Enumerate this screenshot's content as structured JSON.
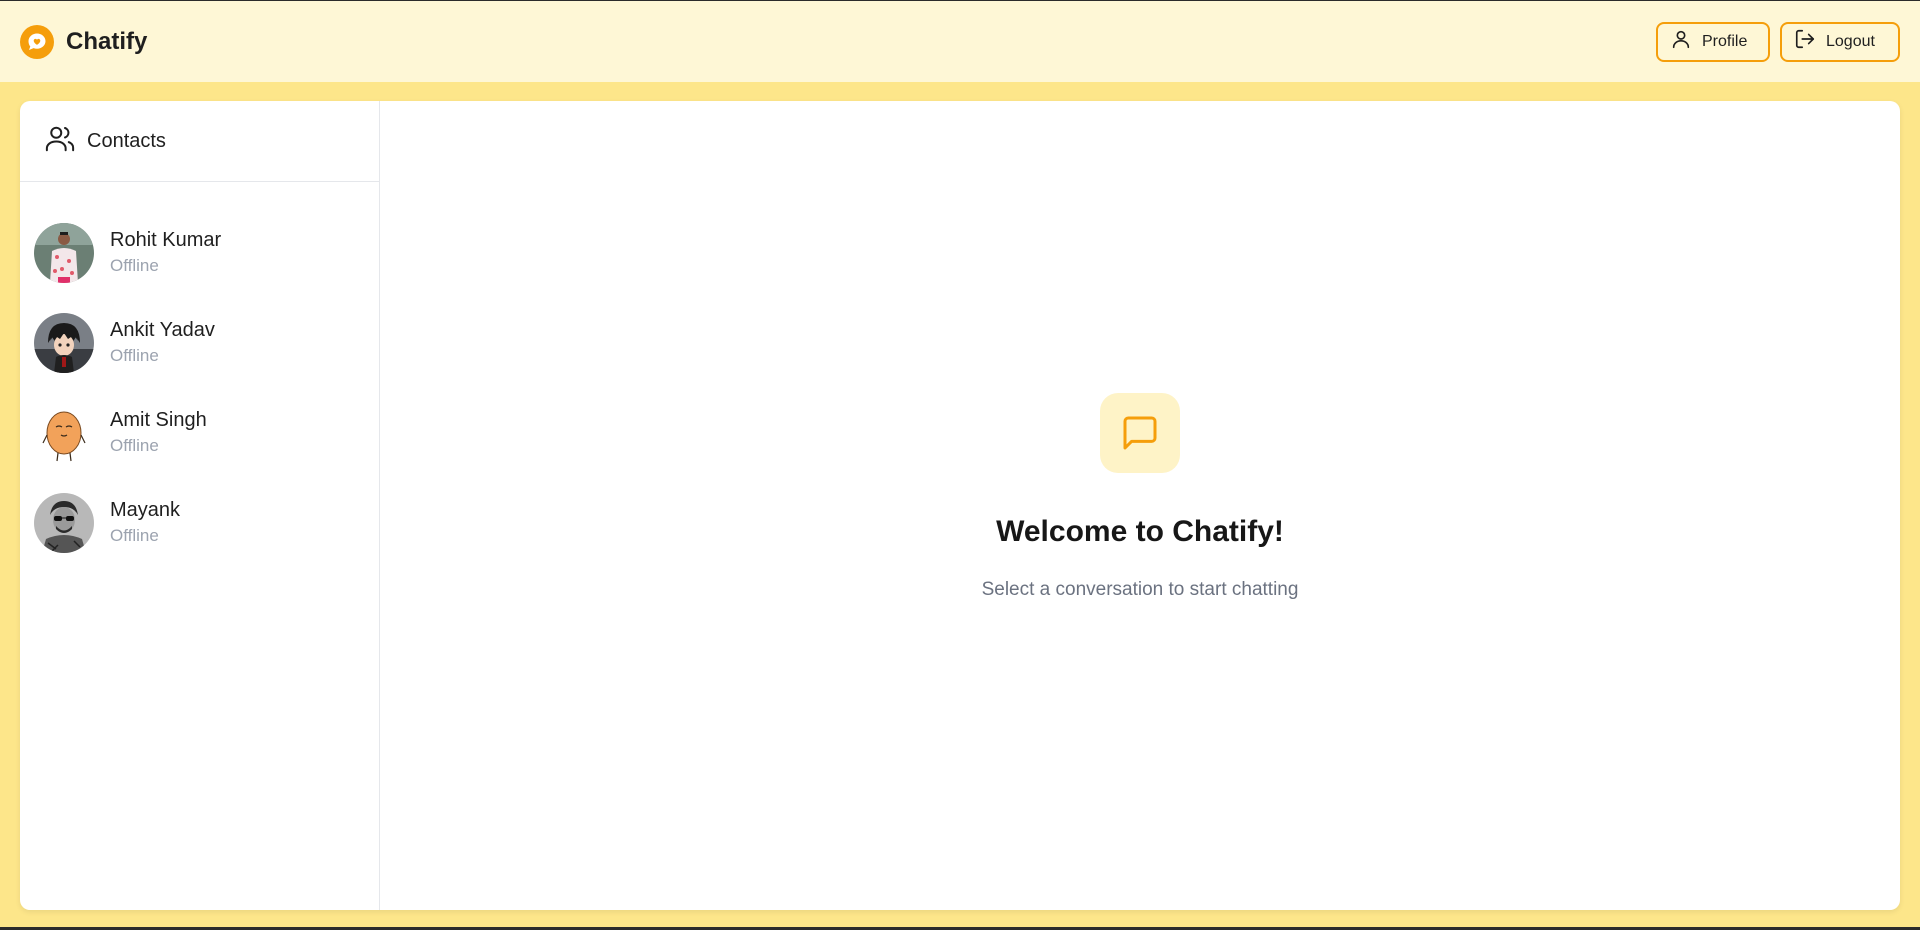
{
  "header": {
    "brand": "Chatify",
    "profile_label": "Profile",
    "logout_label": "Logout"
  },
  "sidebar": {
    "title": "Contacts",
    "contacts": [
      {
        "name": "Rohit Kumar",
        "status": "Offline"
      },
      {
        "name": "Ankit Yadav",
        "status": "Offline"
      },
      {
        "name": "Amit Singh",
        "status": "Offline"
      },
      {
        "name": "Mayank",
        "status": "Offline"
      }
    ]
  },
  "main": {
    "welcome_title": "Welcome to Chatify!",
    "welcome_subtitle": "Select a conversation to start chatting"
  },
  "icons": {
    "brand": "chat-heart-icon",
    "profile": "user-icon",
    "logout": "logout-icon",
    "contacts": "users-icon",
    "welcome": "message-square-icon"
  },
  "colors": {
    "accent": "#f59e0b",
    "background": "#fde68a",
    "header": "#fef7d6",
    "muted": "#9ca3af"
  }
}
